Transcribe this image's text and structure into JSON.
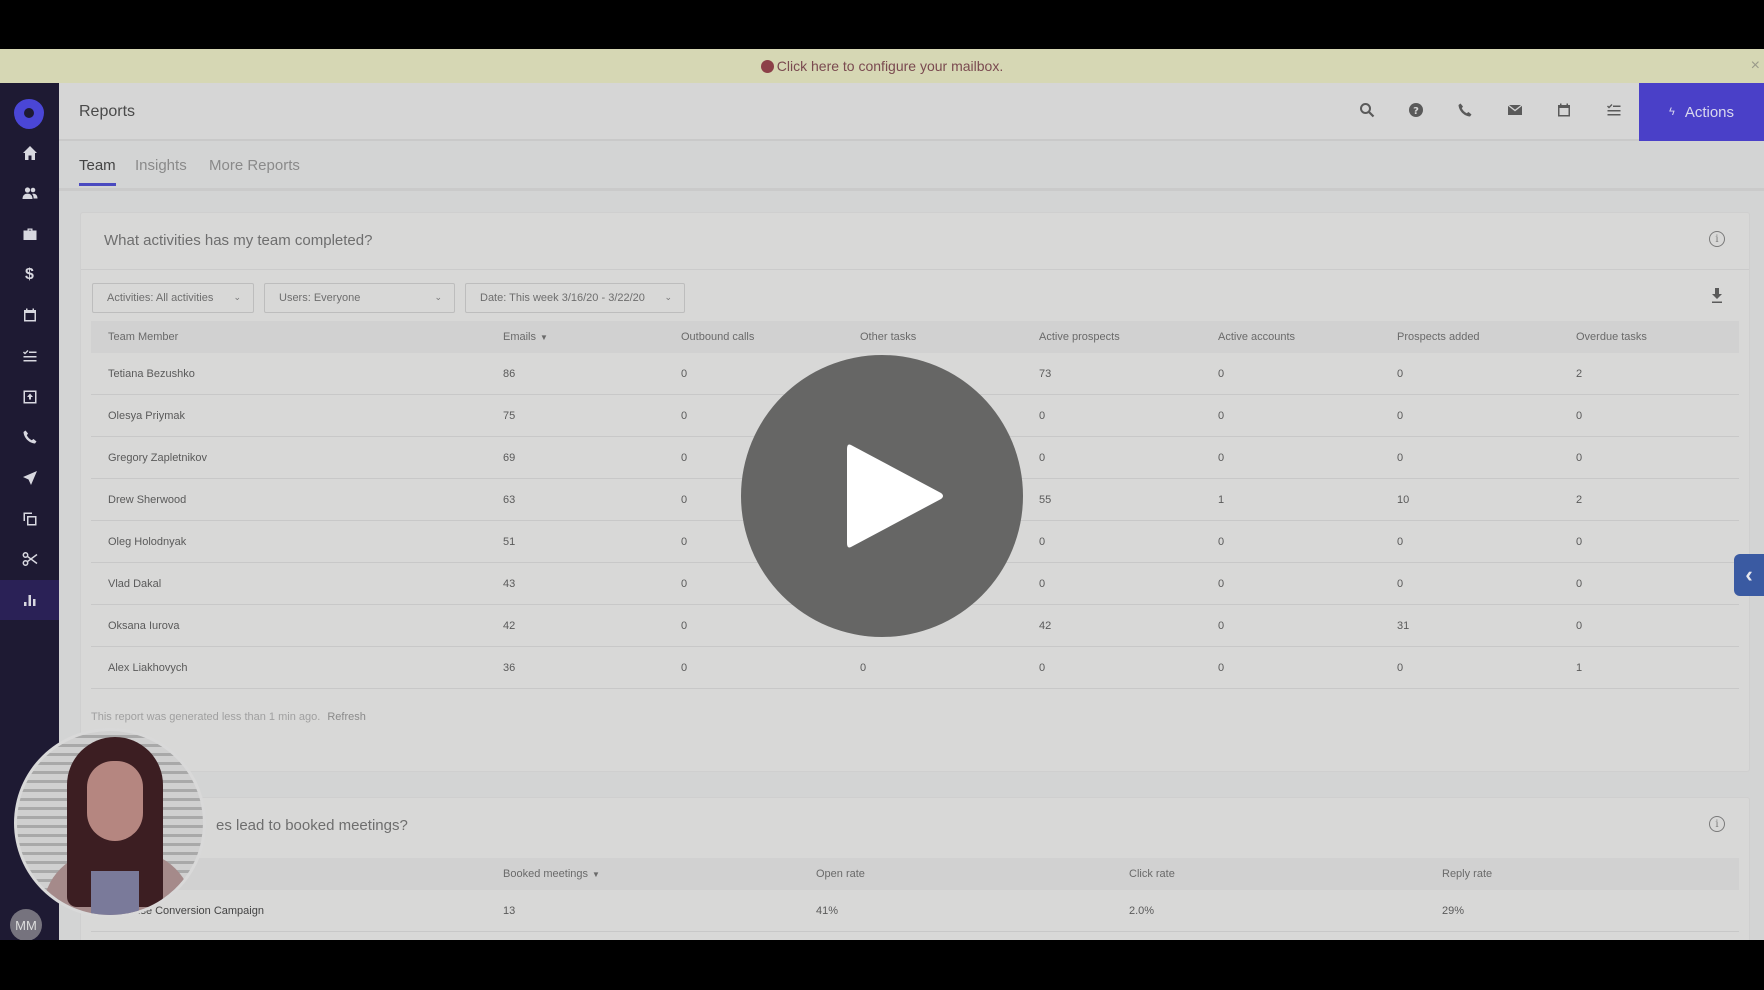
{
  "banner": {
    "text": "Click here to configure your mailbox.",
    "close_icon": "close-icon"
  },
  "sidebar": {
    "logo": "outreach-logo",
    "items": [
      {
        "name": "home",
        "icon": "home-icon",
        "active": false
      },
      {
        "name": "prospects",
        "icon": "people-icon",
        "active": false
      },
      {
        "name": "accounts",
        "icon": "briefcase-icon",
        "active": false
      },
      {
        "name": "opportunities",
        "icon": "dollar-icon",
        "active": false
      },
      {
        "name": "meetings",
        "icon": "calendar-icon",
        "active": false
      },
      {
        "name": "tasks",
        "icon": "task-list-icon",
        "active": false
      },
      {
        "name": "inbox",
        "icon": "inbox-icon",
        "active": false
      },
      {
        "name": "calls",
        "icon": "phone-icon",
        "active": false
      },
      {
        "name": "sequences",
        "icon": "send-icon",
        "active": false
      },
      {
        "name": "templates",
        "icon": "copy-icon",
        "active": false
      },
      {
        "name": "snippets",
        "icon": "scissors-icon",
        "active": false
      },
      {
        "name": "reports",
        "icon": "bar-chart-icon",
        "active": true
      }
    ],
    "avatar_initials": "MM"
  },
  "header": {
    "title": "Reports",
    "icons": [
      "search-icon",
      "help-icon",
      "phone-icon",
      "mail-icon",
      "calendar-icon",
      "task-list-icon"
    ],
    "actions_label": "Actions"
  },
  "tabs": [
    {
      "label": "Team",
      "active": true
    },
    {
      "label": "Insights",
      "active": false
    },
    {
      "label": "More Reports",
      "active": false
    }
  ],
  "activity_report": {
    "title": "What activities has my team completed?",
    "filters": {
      "activities": "Activities: All activities",
      "users": "Users: Everyone",
      "date": "Date: This week 3/16/20 - 3/22/20"
    },
    "columns": [
      "Team Member",
      "Emails",
      "Outbound calls",
      "Other tasks",
      "Active prospects",
      "Active accounts",
      "Prospects added",
      "Overdue tasks"
    ],
    "sorted_column": "Emails",
    "rows": [
      {
        "member": "Tetiana Bezushko",
        "emails": "86",
        "calls": "0",
        "other": "",
        "prospects": "73",
        "accounts": "0",
        "added": "0",
        "overdue": "2"
      },
      {
        "member": "Olesya Priymak",
        "emails": "75",
        "calls": "0",
        "other": "",
        "prospects": "0",
        "accounts": "0",
        "added": "0",
        "overdue": "0"
      },
      {
        "member": "Gregory Zapletnikov",
        "emails": "69",
        "calls": "0",
        "other": "",
        "prospects": "0",
        "accounts": "0",
        "added": "0",
        "overdue": "0"
      },
      {
        "member": "Drew Sherwood",
        "emails": "63",
        "calls": "0",
        "other": "",
        "prospects": "55",
        "accounts": "1",
        "added": "10",
        "overdue": "2"
      },
      {
        "member": "Oleg Holodnyak",
        "emails": "51",
        "calls": "0",
        "other": "",
        "prospects": "0",
        "accounts": "0",
        "added": "0",
        "overdue": "0"
      },
      {
        "member": "Vlad Dakal",
        "emails": "43",
        "calls": "0",
        "other": "",
        "prospects": "0",
        "accounts": "0",
        "added": "0",
        "overdue": "0"
      },
      {
        "member": "Oksana Iurova",
        "emails": "42",
        "calls": "0",
        "other": "",
        "prospects": "42",
        "accounts": "0",
        "added": "31",
        "overdue": "0"
      },
      {
        "member": "Alex Liakhovych",
        "emails": "36",
        "calls": "0",
        "other": "0",
        "prospects": "0",
        "accounts": "0",
        "added": "0",
        "overdue": "1"
      }
    ],
    "footer_note": "This report was generated less than 1 min ago.",
    "refresh_label": "Refresh"
  },
  "meetings_report": {
    "title_visible": "es lead to booked meetings?",
    "columns": [
      "Booked meetings",
      "Open rate",
      "Click rate",
      "Reply rate"
    ],
    "sorted_column": "Booked meetings",
    "rows": [
      {
        "name_visible": "ise Conversion Campaign",
        "booked": "13",
        "open": "41%",
        "click": "2.0%",
        "reply": "29%"
      }
    ]
  },
  "video_overlay": {
    "play_icon": "play-icon"
  },
  "colors": {
    "accent": "#4a40c8",
    "sidebar_bg": "#1e1a33",
    "banner_bg": "#d6d7b4",
    "side_tab": "#3a5aa2"
  }
}
